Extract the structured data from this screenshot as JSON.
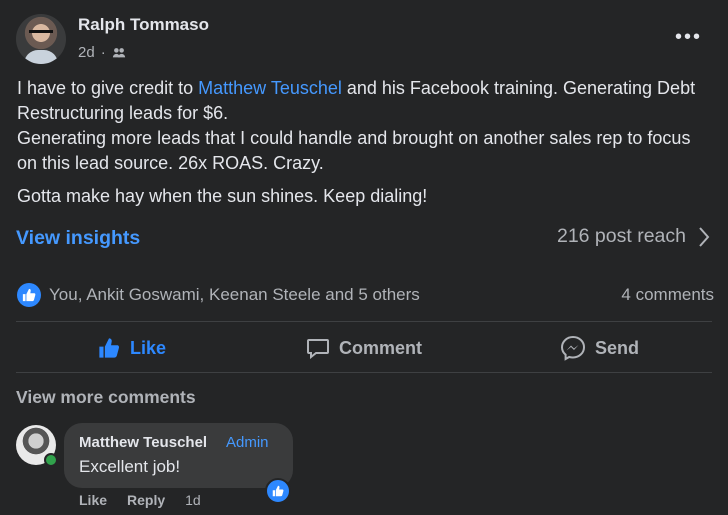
{
  "post": {
    "author": "Ralph Tommaso",
    "time": "2d",
    "privacy_icon": "friends-icon",
    "text_before_mention": "I have to give credit to ",
    "mention": "Matthew Teuschel",
    "text_after_mention": " and his Facebook training.  Generating Debt Restructuring leads for $6.",
    "paragraph2": "Generating more leads that I could handle and brought on another sales rep to focus on this lead source.  26x ROAS.  Crazy.",
    "paragraph3": "Gotta make hay when the sun shines.  Keep dialing!"
  },
  "insights": {
    "label": "View insights",
    "reach": "216 post reach"
  },
  "reactions": {
    "summary": "You, Ankit Goswami, Keenan Steele and 5 others",
    "comments": "4 comments"
  },
  "actions": {
    "like": "Like",
    "comment": "Comment",
    "send": "Send"
  },
  "comments": {
    "view_more": "View more comments",
    "items": [
      {
        "author": "Matthew Teuschel",
        "badge": "Admin",
        "text": "Excellent job!",
        "like": "Like",
        "reply": "Reply",
        "time": "1d"
      }
    ]
  },
  "colors": {
    "background": "#242526",
    "accent": "#2d88ff",
    "link": "#4599ff",
    "online": "#31a24c"
  }
}
